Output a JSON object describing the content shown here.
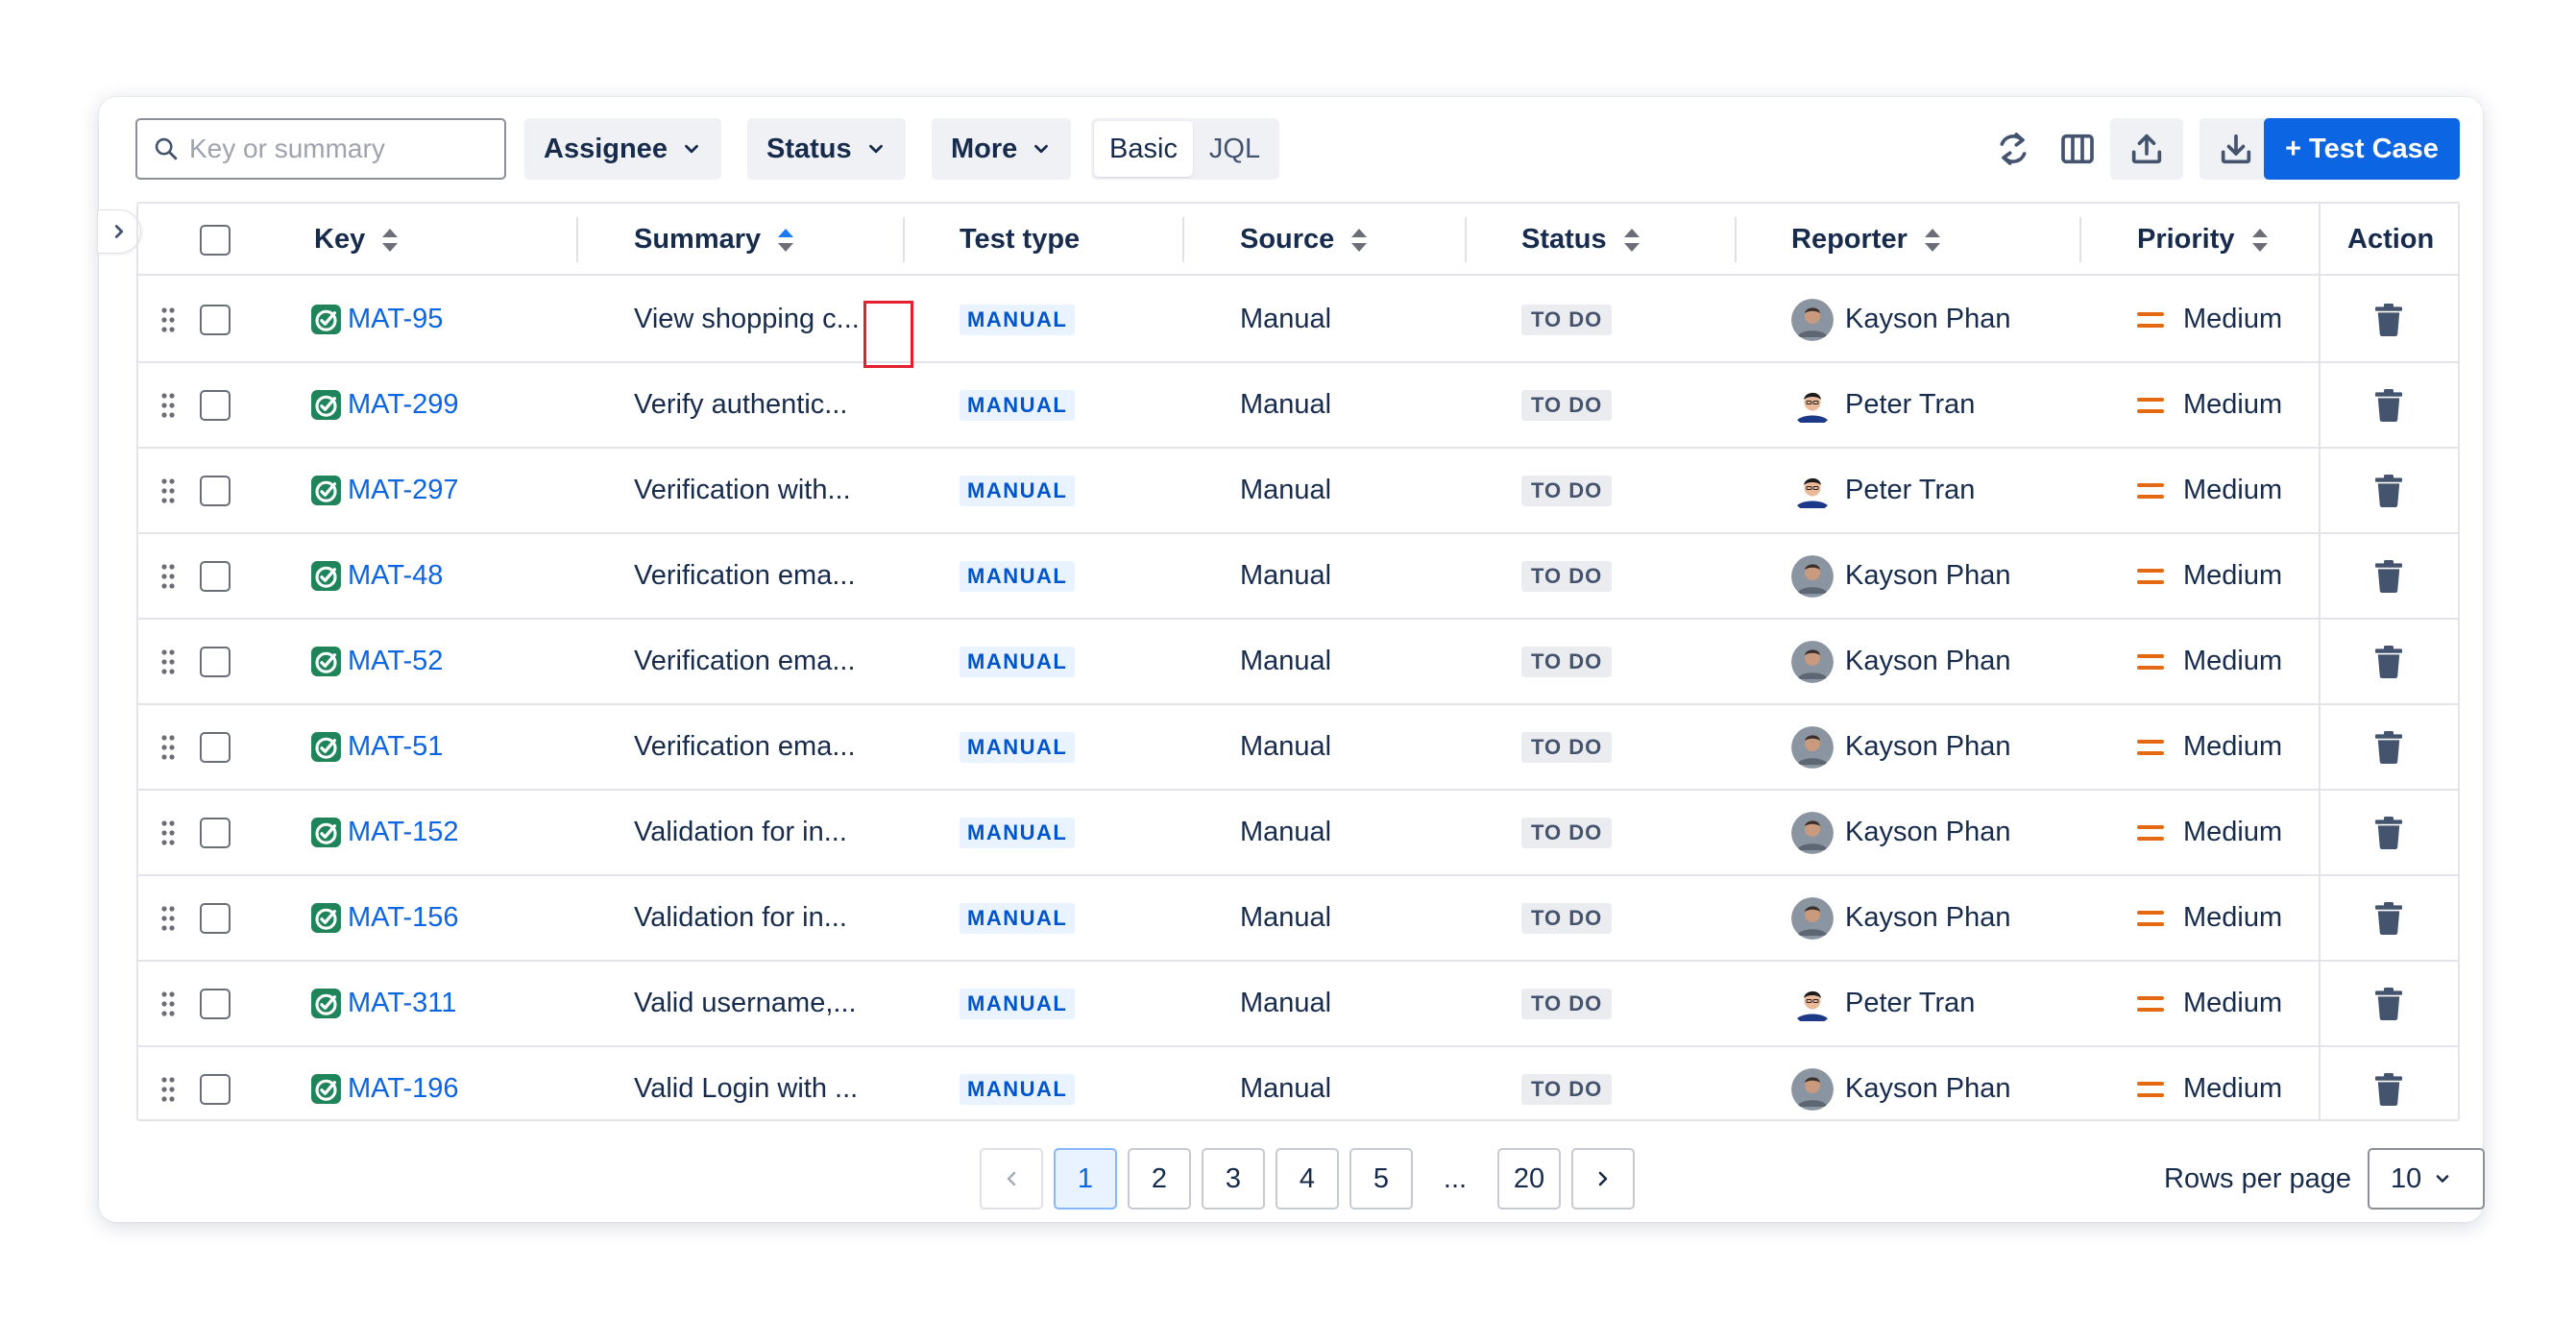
{
  "toolbar": {
    "search_placeholder": "Key or summary",
    "filters": [
      "Assignee",
      "Status",
      "More"
    ],
    "mode_basic": "Basic",
    "mode_jql": "JQL",
    "create_label": "+ Test Case"
  },
  "columns": {
    "key": "Key",
    "summary": "Summary",
    "test_type": "Test type",
    "source": "Source",
    "status": "Status",
    "reporter": "Reporter",
    "priority": "Priority",
    "action": "Action"
  },
  "rows": [
    {
      "key": "MAT-95",
      "summary": "View shopping c...",
      "test_type": "MANUAL",
      "source": "Manual",
      "status": "TO DO",
      "reporter": "Kayson Phan",
      "priority": "Medium"
    },
    {
      "key": "MAT-299",
      "summary": "Verify authentic...",
      "test_type": "MANUAL",
      "source": "Manual",
      "status": "TO DO",
      "reporter": "Peter Tran",
      "priority": "Medium"
    },
    {
      "key": "MAT-297",
      "summary": "Verification with...",
      "test_type": "MANUAL",
      "source": "Manual",
      "status": "TO DO",
      "reporter": "Peter Tran",
      "priority": "Medium"
    },
    {
      "key": "MAT-48",
      "summary": "Verification ema...",
      "test_type": "MANUAL",
      "source": "Manual",
      "status": "TO DO",
      "reporter": "Kayson Phan",
      "priority": "Medium"
    },
    {
      "key": "MAT-52",
      "summary": "Verification ema...",
      "test_type": "MANUAL",
      "source": "Manual",
      "status": "TO DO",
      "reporter": "Kayson Phan",
      "priority": "Medium"
    },
    {
      "key": "MAT-51",
      "summary": "Verification ema...",
      "test_type": "MANUAL",
      "source": "Manual",
      "status": "TO DO",
      "reporter": "Kayson Phan",
      "priority": "Medium"
    },
    {
      "key": "MAT-152",
      "summary": "Validation for in...",
      "test_type": "MANUAL",
      "source": "Manual",
      "status": "TO DO",
      "reporter": "Kayson Phan",
      "priority": "Medium"
    },
    {
      "key": "MAT-156",
      "summary": "Validation for in...",
      "test_type": "MANUAL",
      "source": "Manual",
      "status": "TO DO",
      "reporter": "Kayson Phan",
      "priority": "Medium"
    },
    {
      "key": "MAT-311",
      "summary": "Valid username,...",
      "test_type": "MANUAL",
      "source": "Manual",
      "status": "TO DO",
      "reporter": "Peter Tran",
      "priority": "Medium"
    },
    {
      "key": "MAT-196",
      "summary": "Valid Login with ...",
      "test_type": "MANUAL",
      "source": "Manual",
      "status": "TO DO",
      "reporter": "Kayson Phan",
      "priority": "Medium"
    }
  ],
  "pagination": {
    "pages": [
      "1",
      "2",
      "3",
      "4",
      "5"
    ],
    "ellipsis": "...",
    "last_page": "20",
    "current_page": "1",
    "rows_per_page_label": "Rows per page",
    "rows_per_page": "10"
  },
  "colors": {
    "primary": "#0c66e4",
    "lozenge_manual_bg": "#e9f2ff",
    "priority_medium": "#e56910",
    "key_icon": "#22a06b",
    "highlight": "#e5202e"
  },
  "icons": {
    "search": "search-icon",
    "chevron": "chevron-down-icon",
    "refresh": "refresh-icon",
    "columns": "columns-icon",
    "export": "upload-icon",
    "import": "download-icon",
    "drag": "drag-handle-icon",
    "test_case": "test-case-icon",
    "priority": "priority-medium-icon",
    "delete": "trash-icon",
    "sort": "sort-icon"
  }
}
